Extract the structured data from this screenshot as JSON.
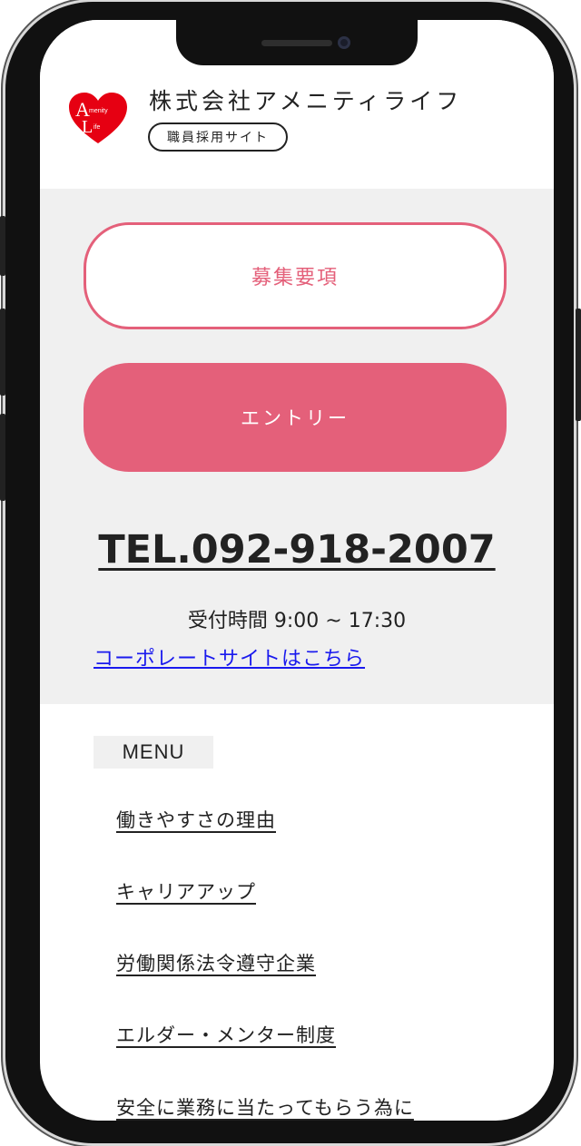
{
  "header": {
    "company_name": "株式会社アメニティライフ",
    "site_badge": "職員採用サイト",
    "logo_text_top": "menity",
    "logo_text_bottom": "ife"
  },
  "actions": {
    "requirements_label": "募集要項",
    "entry_label": "エントリー"
  },
  "contact": {
    "tel": "TEL.092-918-2007",
    "hours": "受付時間 9:00 ~ 17:30",
    "corporate_link": "コーポレートサイトはこちら"
  },
  "menu": {
    "label": "MENU",
    "items": [
      {
        "label": "働きやすさの理由"
      },
      {
        "label": "キャリアアップ"
      },
      {
        "label": "労働関係法令遵守企業"
      },
      {
        "label": "エルダー・メンター制度"
      },
      {
        "label": "安全に業務に当たってもらう為に"
      }
    ]
  },
  "colors": {
    "accent": "#e4607a",
    "panel": "#f0f0f0",
    "link": "#1a1aee",
    "logo_red": "#e60012"
  }
}
